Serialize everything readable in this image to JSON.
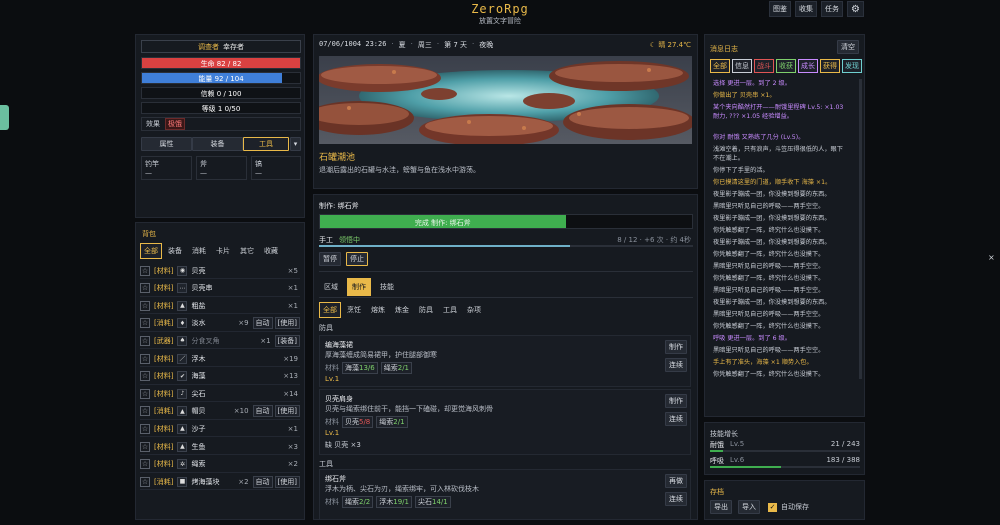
{
  "app": {
    "title": "ZeroRpg",
    "subtitle": "放置文字冒险"
  },
  "topnav": {
    "items": [
      "图鉴",
      "收集",
      "任务"
    ],
    "settings_icon": "gear-icon"
  },
  "character": {
    "title_label": "调查者",
    "title_name": "幸存者",
    "hp": {
      "label": "生命 82 / 82",
      "ratio": 1.0,
      "color": "#d94141"
    },
    "mp": {
      "label": "能量 92 / 104",
      "ratio": 0.885,
      "color": "#3f7fd9"
    },
    "trust": "信赖 0 / 100",
    "level": "等级 1 0/50",
    "effect_label": "效果",
    "effect_badge": "极饿",
    "tabs": [
      "属性",
      "装备",
      "工具"
    ],
    "active_tab": "工具",
    "dropdown_icon": "chevron-down-icon",
    "tool_slots": [
      {
        "label": "钓竿",
        "value": "—"
      },
      {
        "label": "斧",
        "value": "—"
      },
      {
        "label": "镐",
        "value": "—"
      }
    ]
  },
  "backpack": {
    "title": "背包",
    "tabs": [
      "全部",
      "装备",
      "消耗",
      "卡片",
      "其它",
      "收藏"
    ],
    "active_tab": "全部",
    "items": [
      {
        "tag": "[材料]",
        "icon": "shell-icon",
        "glyph": "◉",
        "name": "贝壳",
        "count": "×5",
        "actions": []
      },
      {
        "tag": "[材料]",
        "icon": "shell-fragment-icon",
        "glyph": "⋯",
        "name": "贝壳串",
        "count": "×1",
        "actions": []
      },
      {
        "tag": "[材料]",
        "icon": "sand-icon",
        "glyph": "▲",
        "name": "粗盐",
        "count": "×1",
        "actions": []
      },
      {
        "tag": "[消耗]",
        "icon": "water-drop-icon",
        "glyph": "♦",
        "name": "淡水",
        "count": "×9",
        "actions": [
          "自动",
          "[使用]"
        ]
      },
      {
        "tag": "[武器]",
        "icon": "sword-icon",
        "glyph": "♠",
        "name": "分食叉角",
        "count": "×1",
        "actions": [
          "[装备]"
        ],
        "dim": true
      },
      {
        "tag": "[材料]",
        "icon": "driftwood-icon",
        "glyph": "／",
        "name": "浮木",
        "count": "×19",
        "actions": []
      },
      {
        "tag": "[材料]",
        "icon": "seaweed-icon",
        "glyph": "✔",
        "name": "海藻",
        "count": "×13",
        "actions": []
      },
      {
        "tag": "[材料]",
        "icon": "sharp-stone-icon",
        "glyph": "♪",
        "name": "尖石",
        "count": "×14",
        "actions": []
      },
      {
        "tag": "[消耗]",
        "icon": "clam-icon",
        "glyph": "▲",
        "name": "帽贝",
        "count": "×10",
        "actions": [
          "自动",
          "[使用]"
        ]
      },
      {
        "tag": "[材料]",
        "icon": "sand-pile-icon",
        "glyph": "▲",
        "name": "沙子",
        "count": "×1",
        "actions": []
      },
      {
        "tag": "[材料]",
        "icon": "fish-icon",
        "glyph": "▲",
        "name": "生鱼",
        "count": "×3",
        "actions": []
      },
      {
        "tag": "[材料]",
        "icon": "rope-icon",
        "glyph": "✲",
        "name": "绳索",
        "count": "×2",
        "actions": []
      },
      {
        "tag": "[消耗]",
        "icon": "food-icon",
        "glyph": "■",
        "name": "烤海藻块",
        "count": "×2",
        "actions": [
          "自动",
          "[使用]"
        ]
      }
    ]
  },
  "location": {
    "datetime": "07/06/1004 23:26",
    "season": "夏",
    "weekday": "周三",
    "day": "第 7 天",
    "period": "夜晚",
    "weather": "晴 27.4℃",
    "name": "石罐潮池",
    "description": "退潮后露出的石罐与水洼，螃蟹与鱼在浅水中游荡。"
  },
  "crafting": {
    "header": "制作: 绑石斧",
    "progress_label": "完成 制作: 绑石斧",
    "progress_ratio": 0.66,
    "skill_name": "手工",
    "skill_status": "领悟中",
    "skill_stats": "8 / 12 · +6 次 · 约 4秒",
    "skill_ratio": 0.67,
    "pause_label": "暂停",
    "stop_label": "停止",
    "mode_tabs": [
      "区域",
      "制作",
      "技能"
    ],
    "active_mode": "制作",
    "category_tabs": [
      "全部",
      "烹饪",
      "熔炼",
      "炼金",
      "防具",
      "工具",
      "杂项"
    ],
    "active_category": "全部",
    "section_armor": "防具",
    "section_tools": "工具",
    "material_label": "材料",
    "recipes": [
      {
        "name": "编海藻裙",
        "desc": "厚海藻缠成简易裙甲，护住腿部御寒",
        "materials": [
          {
            "n": "海藻",
            "q": "13/6"
          },
          {
            "n": "绳索",
            "q": "2/1"
          }
        ],
        "level": "Lv.1",
        "buttons": [
          "制作",
          "连续"
        ]
      },
      {
        "name": "贝壳肩身",
        "desc": "贝壳与绳索绑住前干，能挡一下磕碰，却更觉海风刺骨",
        "materials": [
          {
            "n": "贝壳",
            "q": "5/8"
          },
          {
            "n": "绳索",
            "q": "2/1"
          }
        ],
        "level": "Lv.1",
        "missing": "缺 贝壳 ×3",
        "buttons": [
          "制作",
          "连续"
        ]
      },
      {
        "name": "绑石斧",
        "desc": "浮木为柄、尖石为刃，绳索绑牢，可入林砍伐枝木",
        "materials": [
          {
            "n": "绳索",
            "q": "2/2"
          },
          {
            "n": "浮木",
            "q": "19/1"
          },
          {
            "n": "尖石",
            "q": "14/1"
          }
        ],
        "buttons": [
          "再做",
          "连续"
        ]
      }
    ]
  },
  "log": {
    "title": "消息日志",
    "clear_label": "清空",
    "filters": [
      "全部",
      "信息",
      "战斗",
      "收获",
      "成长",
      "获得",
      "发现"
    ],
    "filter_colors": [
      "#e9b949",
      "#c9ced6",
      "#e05555",
      "#7ed06b",
      "#c88bff",
      "#e9b949",
      "#6fd0d0"
    ],
    "lines": [
      {
        "t": "选择 更进一层。到了 2 级。",
        "c": "#c88bff"
      },
      {
        "t": "你做出了 贝壳串 ×1。",
        "c": "#e9b949"
      },
      {
        "t": "某个夹向酷然打开——耐饿里程碑 Lv.5: ×1.03 耐力, ??? ×1.05 经验增益。",
        "c": "#c88bff"
      },
      {
        "t": "你对 耐饿 又熟练了几分 (Lv.5)。",
        "c": "#c88bff"
      },
      {
        "t": "浅滩空着，只有浪声，斗笠压得很低的人，眼下不在潮上。",
        "c": "#c9ced6"
      },
      {
        "t": "你停下了手里的活。",
        "c": "#c9ced6"
      },
      {
        "t": "你已摸清这里的门道，顺手收下 海藻 ×1。",
        "c": "#e9b949"
      },
      {
        "t": "夜里影子蹦成一团，你没摸到想要的东西。",
        "c": "#c9ced6"
      },
      {
        "t": "黑暗里只听见自己的呼吸——两手空空。",
        "c": "#c9ced6"
      },
      {
        "t": "夜里影子蹦成一团，你没摸到想要的东西。",
        "c": "#c9ced6"
      },
      {
        "t": "你凭触感翻了一阵，终究什么也没摸下。",
        "c": "#c9ced6"
      },
      {
        "t": "夜里影子蹦成一团，你没摸到想要的东西。",
        "c": "#c9ced6"
      },
      {
        "t": "你凭触感翻了一阵，终究什么也没摸下。",
        "c": "#c9ced6"
      },
      {
        "t": "黑暗里只听见自己的呼吸——两手空空。",
        "c": "#c9ced6"
      },
      {
        "t": "你凭触感翻了一阵，终究什么也没摸下。",
        "c": "#c9ced6"
      },
      {
        "t": "黑暗里只听见自己的呼吸——两手空空。",
        "c": "#c9ced6"
      },
      {
        "t": "夜里影子蹦成一团，你没摸到想要的东西。",
        "c": "#c9ced6"
      },
      {
        "t": "黑暗里只听见自己的呼吸——两手空空。",
        "c": "#c9ced6"
      },
      {
        "t": "你凭触感翻了一阵，终究什么也没摸下。",
        "c": "#c9ced6"
      },
      {
        "t": "呼吸 更进一层。到了 6 级。",
        "c": "#c88bff"
      },
      {
        "t": "黑暗里只听见自己的呼吸——两手空空。",
        "c": "#c9ced6"
      },
      {
        "t": "手上有了准头，海藻 ×1 顺势入包。",
        "c": "#e9b949"
      },
      {
        "t": "你凭触感翻了一阵，终究什么也没摸下。",
        "c": "#c9ced6"
      }
    ]
  },
  "skills": {
    "title": "技能增长",
    "items": [
      {
        "name": "耐饿",
        "level": "Lv.5",
        "progress": "21 / 243",
        "ratio": 0.086
      },
      {
        "name": "呼吸",
        "level": "Lv.6",
        "progress": "183 / 388",
        "ratio": 0.47
      }
    ]
  },
  "save": {
    "title": "存档",
    "export_label": "导出",
    "import_label": "导入",
    "autosave_label": "自动保存",
    "autosave_checked": true
  }
}
